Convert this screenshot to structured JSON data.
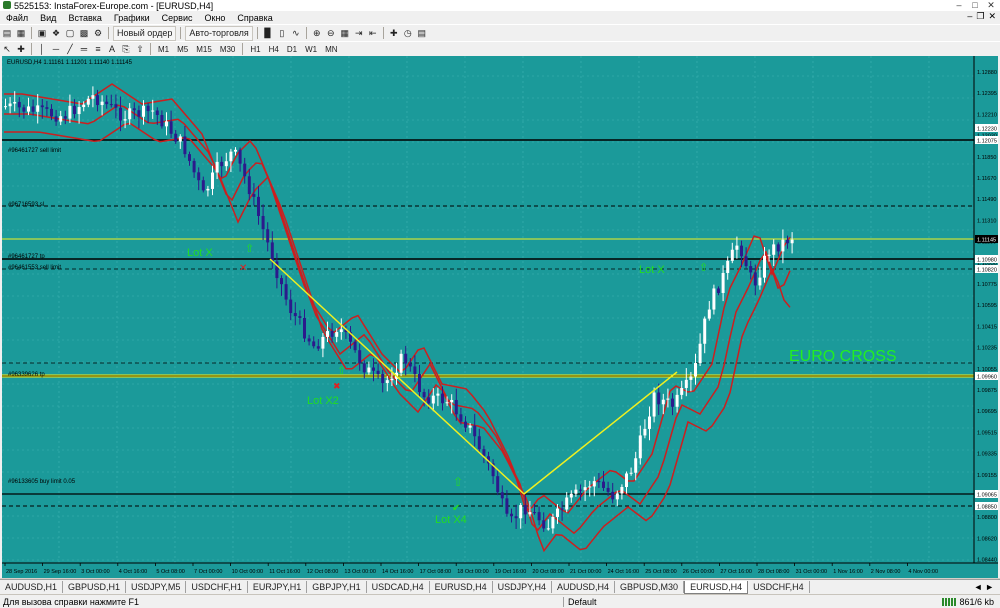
{
  "window": {
    "title": "5525153: InstaForex-Europe.com - [EURUSD,H4]"
  },
  "menu": [
    "Файл",
    "Вид",
    "Вставка",
    "Графики",
    "Сервис",
    "Окно",
    "Справка"
  ],
  "toolbar": {
    "new_order": "Новый ордер",
    "autotrading": "Авто-торговля"
  },
  "timeframes": [
    "M1",
    "M5",
    "M15",
    "M30",
    "H1",
    "H4",
    "D1",
    "W1",
    "MN"
  ],
  "chart": {
    "header": "EURUSD,H4  1.11161 1.11201 1.11140 1.11145",
    "watermark": "EURO CROSS",
    "annotations": {
      "lot1": "Lot X",
      "lot2": "Lot X2",
      "lot3": "Lot X4",
      "lot4": "Lot X"
    },
    "level_labels": {
      "l1": "#96461727 sell limit",
      "l2": "#96716593 sl",
      "l3": "#96461727 tp",
      "l4": "#96461553 sell limit",
      "l5": "#96339626 tp",
      "l6": "#96133605 buy limit 0.05"
    },
    "price_ticks": [
      "1.12880",
      "1.12395",
      "1.12210",
      "1.12030",
      "1.11850",
      "1.11670",
      "1.11490",
      "1.11310",
      "1.11130",
      "1.10950",
      "1.10775",
      "1.10595",
      "1.10415",
      "1.10235",
      "1.10055",
      "1.09875",
      "1.09695",
      "1.09515",
      "1.09335",
      "1.09155",
      "1.08975",
      "1.08800",
      "1.08620",
      "1.08440"
    ],
    "price_tags": {
      "t1": "1.12230",
      "t2": "1.12075",
      "t3": "1.11145",
      "t4": "1.10980",
      "t5": "1.10820",
      "t6": "1.09960",
      "t7": "1.09065",
      "t8": "1.08850"
    },
    "time_ticks": [
      "28 Sep 2016",
      "29 Sep 16:00",
      "3 Oct 00:00",
      "4 Oct 16:00",
      "5 Oct 08:00",
      "7 Oct 00:00",
      "10 Oct 00:00",
      "11 Oct 16:00",
      "12 Oct 08:00",
      "13 Oct 00:00",
      "14 Oct 16:00",
      "17 Oct 08:00",
      "18 Oct 00:00",
      "19 Oct 16:00",
      "20 Oct 08:00",
      "21 Oct 00:00",
      "24 Oct 16:00",
      "25 Oct 08:00",
      "26 Oct 00:00",
      "27 Oct 16:00",
      "28 Oct 08:00",
      "31 Oct 00:00",
      "1 Nov 16:00",
      "2 Nov 08:00",
      "4 Nov 00:00"
    ],
    "colors": {
      "background": "#1b9a9a",
      "grid": "#3fb3b3",
      "bull": "#ffffff",
      "bear": "#2b1a8c",
      "envelope": "#cc1f1f",
      "trendline": "#f0f020",
      "annotation": "#22dd22",
      "level": "#000000"
    }
  },
  "tabs": [
    "AUDUSD,H1",
    "GBPUSD,H1",
    "USDJPY,M5",
    "USDCHF,H1",
    "EURJPY,H1",
    "GBPJPY,H1",
    "USDCAD,H4",
    "EURUSD,H4",
    "USDJPY,H4",
    "AUDUSD,H4",
    "GBPUSD,M30",
    "EURUSD,H4",
    "USDCHF,H4"
  ],
  "active_tab_index": 11,
  "status": {
    "help": "Для вызова справки нажмите F1",
    "profile": "Default",
    "traffic": "861/6 kb"
  }
}
